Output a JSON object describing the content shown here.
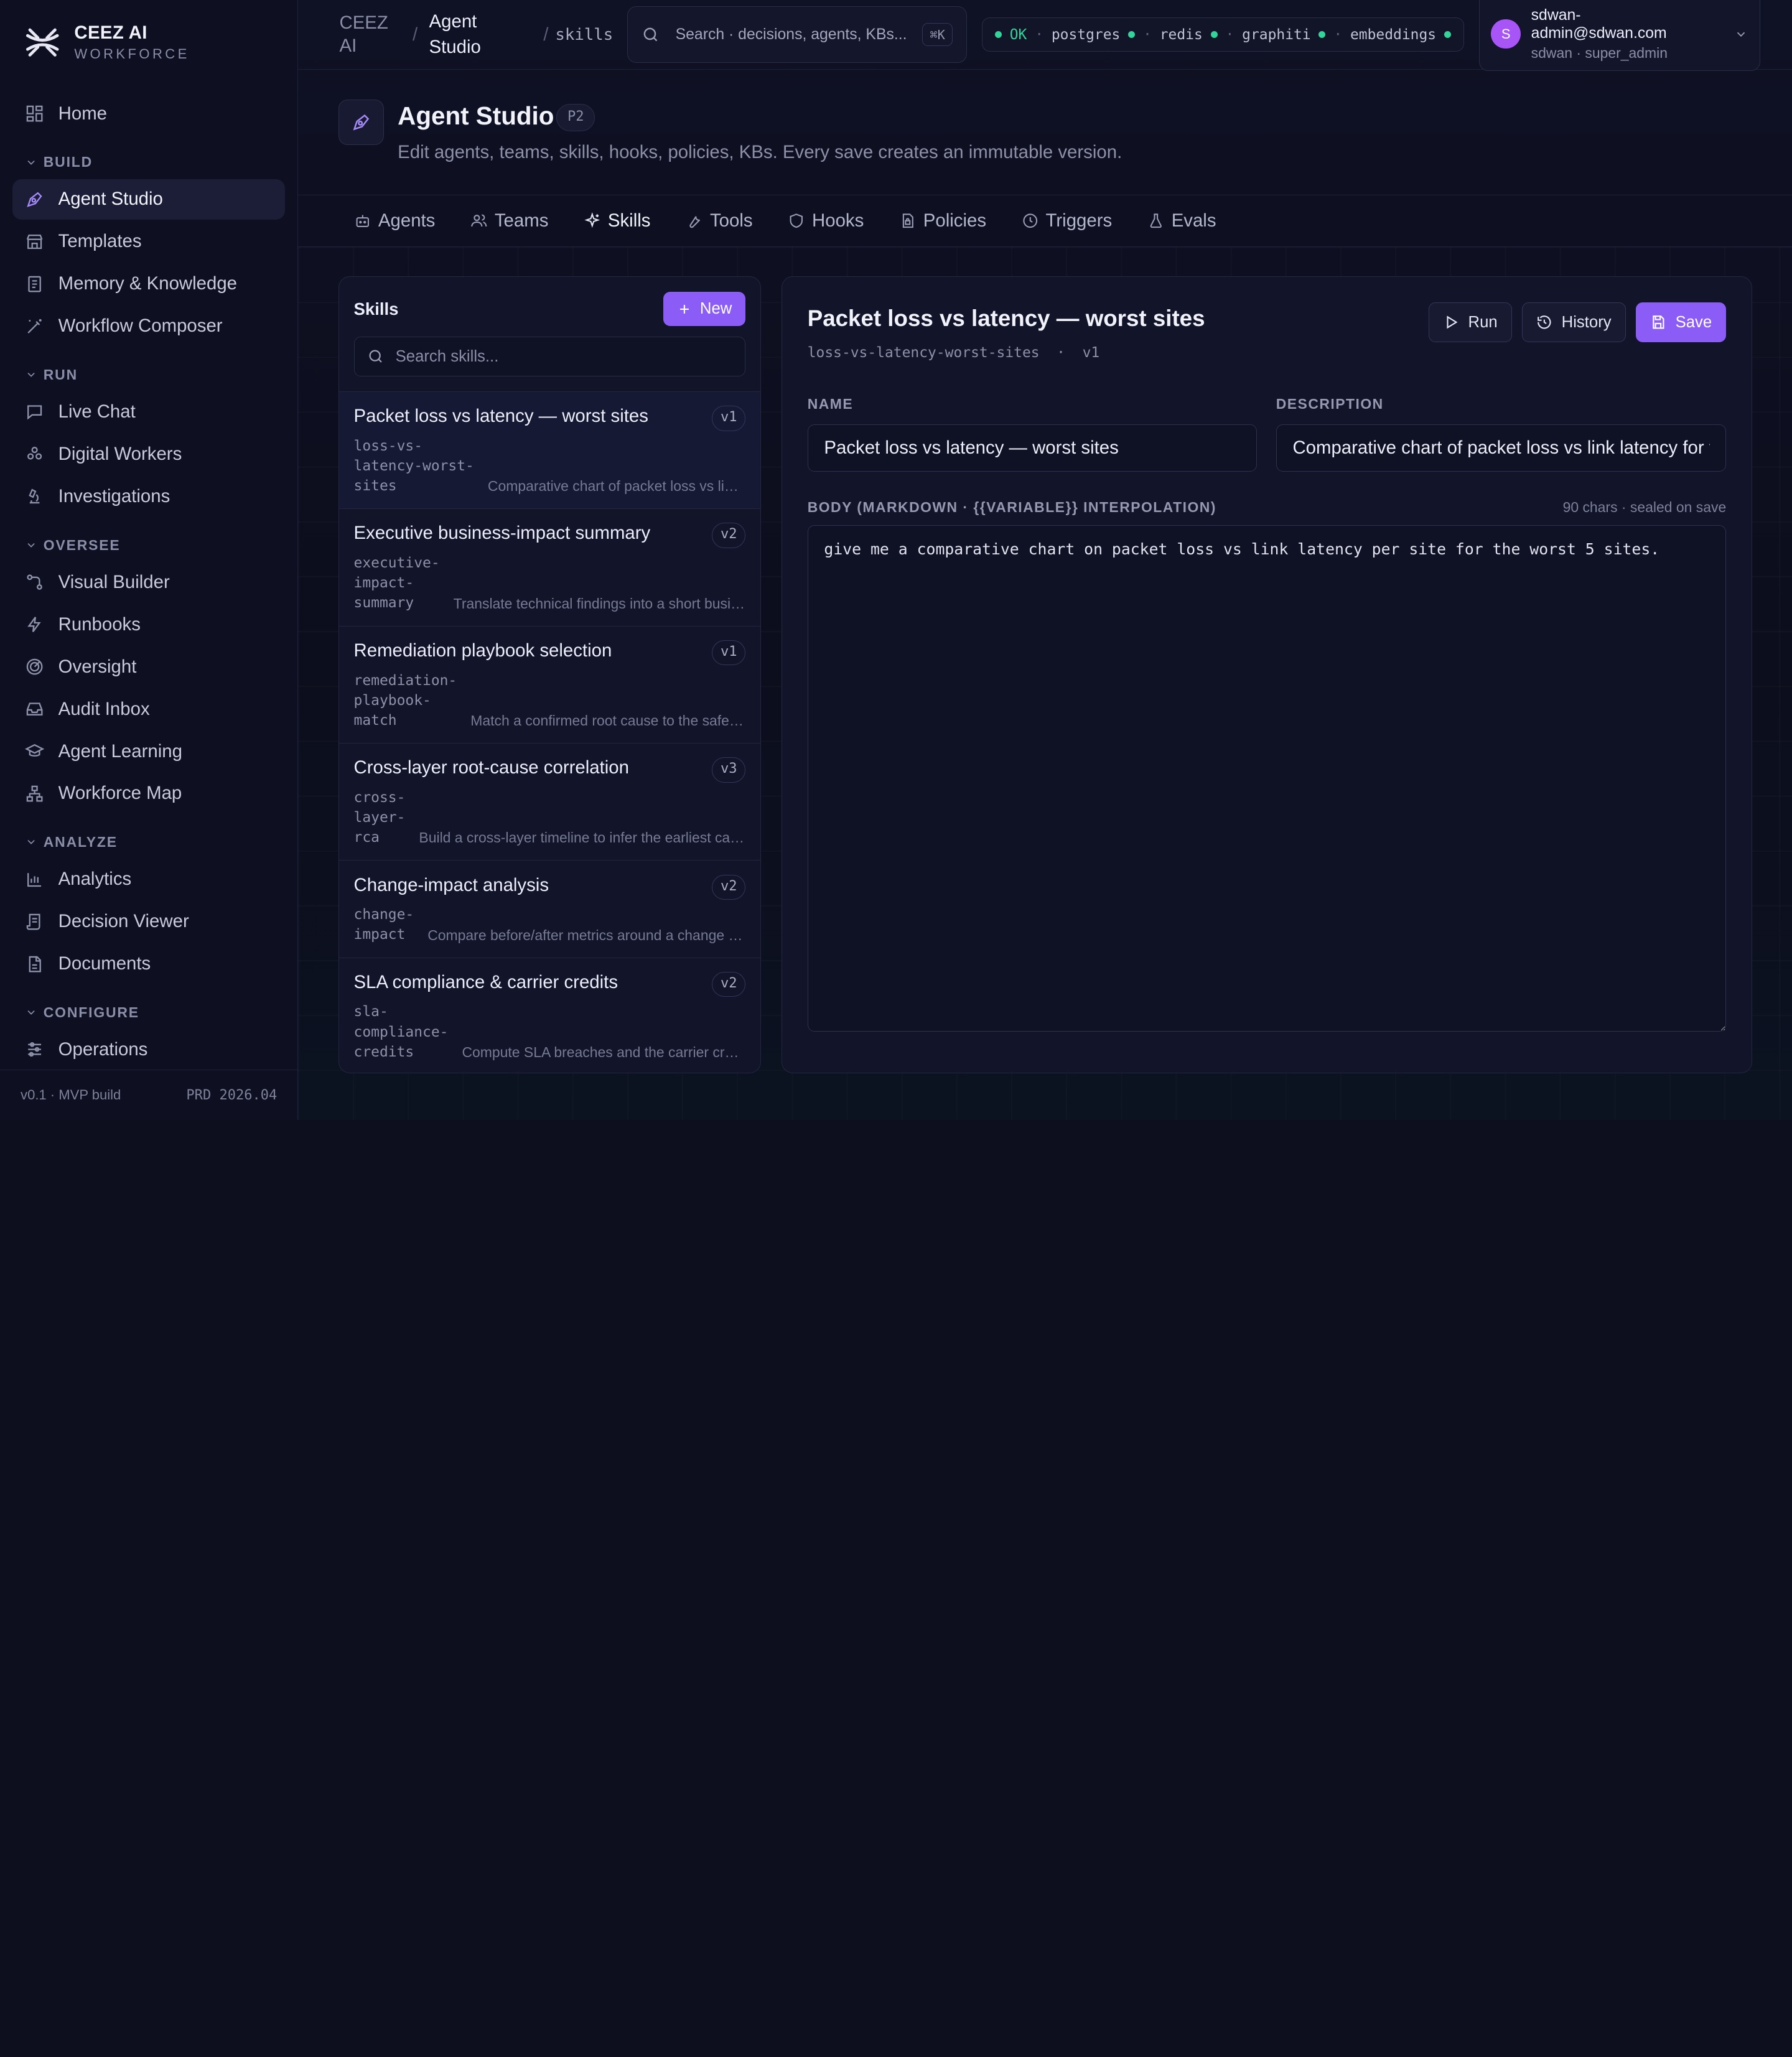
{
  "brand": {
    "name": "CEEZ AI",
    "sub": "WORKFORCE"
  },
  "sidebar": {
    "home": "Home",
    "sections": [
      {
        "label": "BUILD",
        "items": [
          "Agent Studio",
          "Templates",
          "Memory & Knowledge",
          "Workflow Composer"
        ]
      },
      {
        "label": "RUN",
        "items": [
          "Live Chat",
          "Digital Workers",
          "Investigations"
        ]
      },
      {
        "label": "OVERSEE",
        "items": [
          "Visual Builder",
          "Runbooks",
          "Oversight",
          "Audit Inbox",
          "Agent Learning",
          "Workforce Map"
        ]
      },
      {
        "label": "ANALYZE",
        "items": [
          "Analytics",
          "Decision Viewer",
          "Documents"
        ]
      },
      {
        "label": "CONFIGURE",
        "items": [
          "Operations"
        ]
      }
    ],
    "footer_left": "v0.1 · MVP build",
    "footer_right": "PRD 2026.04"
  },
  "topbar": {
    "crumb_root": "CEEZ AI",
    "crumb_page": "Agent Studio",
    "crumb_sub": "skills",
    "search_placeholder": "Search · decisions, agents, KBs...",
    "search_kbd": "⌘K",
    "status": {
      "ok": "OK",
      "services": [
        "postgres",
        "redis",
        "graphiti",
        "embeddings"
      ]
    },
    "user": {
      "email": "sdwan-admin@sdwan.com",
      "role": "sdwan · super_admin",
      "initial": "S"
    }
  },
  "page": {
    "title": "Agent Studio",
    "badge": "P2",
    "subtitle": "Edit agents, teams, skills, hooks, policies, KBs. Every save creates an immutable version."
  },
  "tabs": [
    "Agents",
    "Teams",
    "Skills",
    "Tools",
    "Hooks",
    "Policies",
    "Triggers",
    "Evals"
  ],
  "skills_panel": {
    "title": "Skills",
    "new_label": "New",
    "search_placeholder": "Search skills...",
    "items": [
      {
        "title": "Packet loss vs latency — worst sites",
        "version": "v1",
        "slug": "loss-vs-\nlatency-worst-\nsites",
        "desc": "Comparative chart of packet loss vs link latency per site"
      },
      {
        "title": "Executive business-impact summary",
        "version": "v2",
        "slug": "executive-\nimpact-\nsummary",
        "desc": "Translate technical findings into a short business summary"
      },
      {
        "title": "Remediation playbook selection",
        "version": "v1",
        "slug": "remediation-\nplaybook-\nmatch",
        "desc": "Match a confirmed root cause to the safest playbook"
      },
      {
        "title": "Cross-layer root-cause correlation",
        "version": "v3",
        "slug": "cross-\nlayer-\nrca",
        "desc": "Build a cross-layer timeline to infer the earliest cause"
      },
      {
        "title": "Change-impact analysis",
        "version": "v2",
        "slug": "change-\nimpact",
        "desc": "Compare before/after metrics around a change window"
      },
      {
        "title": "SLA compliance & carrier credits",
        "version": "v2",
        "slug": "sla-\ncompliance-\ncredits",
        "desc": "Compute SLA breaches and the carrier credits owed"
      }
    ]
  },
  "editor": {
    "title": "Packet loss vs latency — worst sites",
    "slug": "loss-vs-latency-worst-sites",
    "version": "v1",
    "run_label": "Run",
    "history_label": "History",
    "save_label": "Save",
    "name_label": "NAME",
    "name_value": "Packet loss vs latency — worst sites",
    "description_label": "DESCRIPTION",
    "description_value": "Comparative chart of packet loss vs link latency for the worst sites",
    "body_label": "BODY (MARKDOWN · {{VARIABLE}} INTERPOLATION)",
    "body_meta": "90 chars · sealed on save",
    "body_value": "give me a comparative chart on packet loss vs link latency per site for the worst 5 sites."
  },
  "colors": {
    "accent": "#8b5cf6",
    "ok": "#34d399",
    "background": "#0d0f1f"
  }
}
